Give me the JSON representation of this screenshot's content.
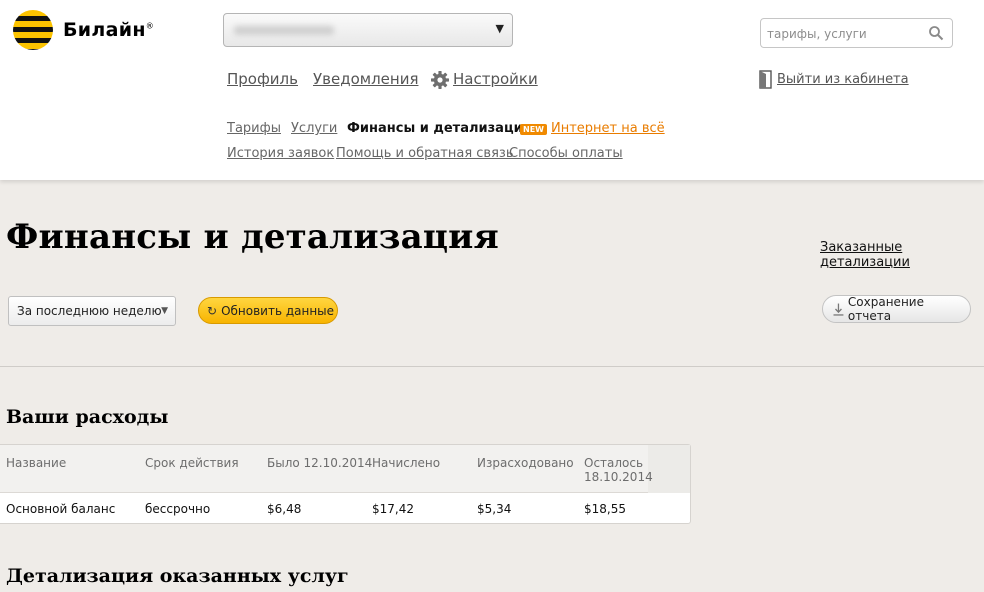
{
  "brand": {
    "name": "Билайн",
    "mark": "®"
  },
  "search": {
    "placeholder": "тарифы, услуги"
  },
  "top_nav": {
    "profile": "Профиль",
    "notifications": "Уведомления",
    "settings": "Настройки",
    "logout": "Выйти из кабинета"
  },
  "sub_nav": {
    "tariffs": "Тарифы",
    "services": "Услуги",
    "finance": "Финансы и детализация",
    "new_badge": "NEW",
    "internet": "Интернет на всё",
    "history": "История заявок",
    "help": "Помощь и обратная связь",
    "payment": "Способы оплаты"
  },
  "page": {
    "title": "Финансы и детализация",
    "ordered_link": "Заказанные детализации"
  },
  "controls": {
    "period_value": "За последнюю неделю",
    "refresh_label": "Обновить данные",
    "save_label": "Сохранение отчета"
  },
  "expenses": {
    "title": "Ваши расходы",
    "headers": [
      "Название",
      "Срок действия",
      "Было 12.10.2014",
      "Начислено",
      "Израсходовано",
      "Осталось 18.10.2014"
    ],
    "rows": [
      [
        "Основной баланс",
        "бессрочно",
        "$6,48",
        "$17,42",
        "$5,34",
        "$18,55"
      ]
    ]
  },
  "details": {
    "title": "Детализация оказанных услуг"
  },
  "colors": {
    "accent_yellow": "#fcc300",
    "link_orange": "#e97c00",
    "background": "#efece8"
  }
}
